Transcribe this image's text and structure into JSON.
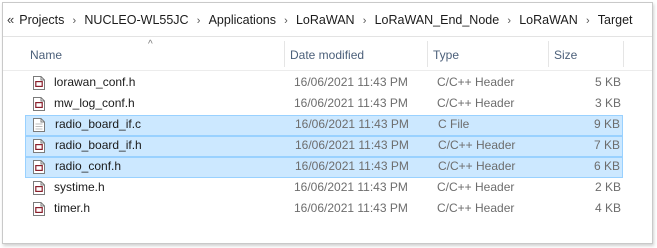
{
  "breadcrumb": {
    "overflow_label": "«",
    "items": [
      "Projects",
      "NUCLEO-WL55JC",
      "Applications",
      "LoRaWAN",
      "LoRaWAN_End_Node",
      "LoRaWAN",
      "Target"
    ],
    "separator": "›"
  },
  "columns": {
    "name": "Name",
    "date": "Date modified",
    "type": "Type",
    "size": "Size",
    "sort_indicator": "^"
  },
  "files": [
    {
      "name": "lorawan_conf.h",
      "date": "16/06/2021 11:43 PM",
      "type": "C/C++ Header",
      "size": "5 KB",
      "icon": "c-header-file-icon",
      "selected": false
    },
    {
      "name": "mw_log_conf.h",
      "date": "16/06/2021 11:43 PM",
      "type": "C/C++ Header",
      "size": "3 KB",
      "icon": "c-header-file-icon",
      "selected": false
    },
    {
      "name": "radio_board_if.c",
      "date": "16/06/2021 11:43 PM",
      "type": "C File",
      "size": "9 KB",
      "icon": "c-file-icon",
      "selected": true
    },
    {
      "name": "radio_board_if.h",
      "date": "16/06/2021 11:43 PM",
      "type": "C/C++ Header",
      "size": "7 KB",
      "icon": "c-header-file-icon",
      "selected": true
    },
    {
      "name": "radio_conf.h",
      "date": "16/06/2021 11:43 PM",
      "type": "C/C++ Header",
      "size": "6 KB",
      "icon": "c-header-file-icon",
      "selected": true
    },
    {
      "name": "systime.h",
      "date": "16/06/2021 11:43 PM",
      "type": "C/C++ Header",
      "size": "2 KB",
      "icon": "c-header-file-icon",
      "selected": false
    },
    {
      "name": "timer.h",
      "date": "16/06/2021 11:43 PM",
      "type": "C/C++ Header",
      "size": "4 KB",
      "icon": "c-header-file-icon",
      "selected": false
    }
  ],
  "colors": {
    "selection_fill": "#cce8ff",
    "selection_border": "#99d1ff",
    "header_text": "#4c607a",
    "icon_accent": "#8a1f2b"
  }
}
